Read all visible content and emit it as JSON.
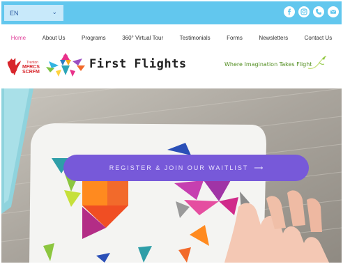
{
  "topbar": {
    "language": "EN",
    "social_icons": [
      "facebook-icon",
      "instagram-icon",
      "phone-icon",
      "mail-icon"
    ],
    "bar_color": "#62c7ee"
  },
  "nav": {
    "items": [
      {
        "label": "Home",
        "active": true
      },
      {
        "label": "About Us"
      },
      {
        "label": "Programs"
      },
      {
        "label": "360° Virtual Tour"
      },
      {
        "label": "Testimonials"
      },
      {
        "label": "Forms"
      },
      {
        "label": "Newsletters"
      },
      {
        "label": "Contact Us"
      }
    ],
    "active_color": "#e0429b"
  },
  "header": {
    "partner_logo_text": [
      "MFRCS",
      "SCRFM"
    ],
    "brand_name": "First Flights",
    "tagline": "Where Imagination Takes Flight"
  },
  "hero": {
    "cta_label": "REGISTER & JOIN OUR WAITLIST",
    "cta_arrow": "⟶",
    "cta_color": "#7759d9"
  }
}
